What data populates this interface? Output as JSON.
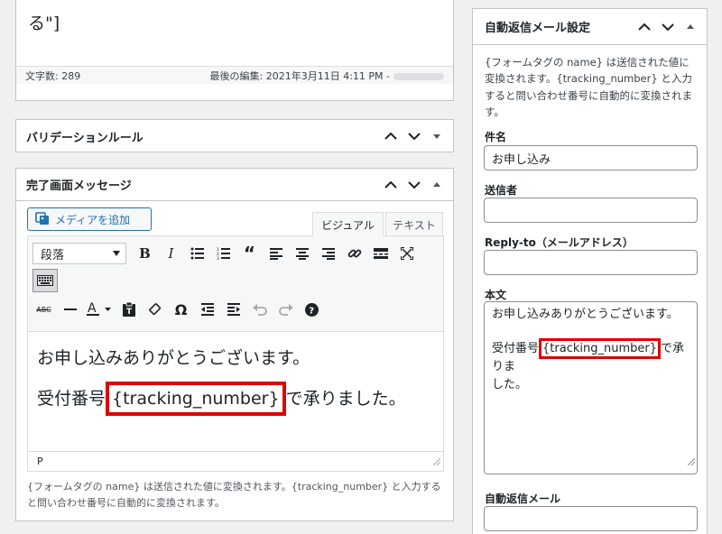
{
  "top_editor": {
    "content_text": "る\"]",
    "word_count": "文字数: 289",
    "last_edit": "最後の編集: 2021年3月11日 4:11 PM -"
  },
  "validation_panel": {
    "title": "バリデーションルール"
  },
  "complete_panel": {
    "title": "完了画面メッセージ",
    "media_button": "メディアを追加",
    "tabs": [
      {
        "label": "ビジュアル"
      },
      {
        "label": "テキスト"
      }
    ],
    "format_select": "段落",
    "body_line1": "お申し込みありがとうございます。",
    "body_line2_prefix": "受付番号",
    "body_tag": "{tracking_number}",
    "body_line2_suffix": "で承りました。",
    "path": "P",
    "description": "{フォームタグの name} は送信された値に変換されます。{tracking_number} と入力すると問い合わせ番号に自動的に変換されます。"
  },
  "autoreply_panel": {
    "title": "自動返信メール設定",
    "description": "{フォームタグの name} は送信された値に変換されます。{tracking_number} と入力すると問い合わせ番号に自動的に変換されます。",
    "subject_label": "件名",
    "subject_value": "お申し込み",
    "sender_label": "送信者",
    "sender_value": "",
    "replyto_label": "Reply-to（メールアドレス）",
    "replyto_value": "",
    "body_label": "本文",
    "body_line1": "お申し込みありがとうございます。",
    "body_prefix": "受付番号",
    "body_tag": "{tracking_number}",
    "body_suffix": "で承りま",
    "body_suffix2": "した。",
    "autoreply_label": "自動返信メール"
  },
  "colors": {
    "highlight": "#e00000",
    "accent": "#2271b1"
  }
}
